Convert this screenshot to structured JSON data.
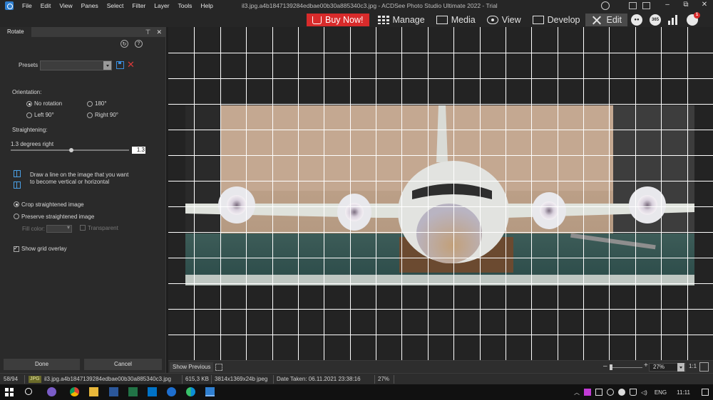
{
  "menu": [
    "File",
    "Edit",
    "View",
    "Panes",
    "Select",
    "Filter",
    "Layer",
    "Tools",
    "Help"
  ],
  "window_title": "il3.jpg.a4b1847139284edbae00b30a885340c3.jpg - ACDSee Photo Studio Ultimate 2022 - Trial",
  "window_controls": {
    "minimize": "–",
    "restore": "⧉",
    "close": "✕"
  },
  "modes": {
    "buy_now": "Buy Now!",
    "manage": "Manage",
    "media": "Media",
    "view": "View",
    "develop": "Develop",
    "edit": "Edit"
  },
  "toolbar_icons": {
    "services_badge": "365",
    "notification_count": "1"
  },
  "panel": {
    "tab": "Rotate",
    "presets_label": "Presets",
    "orientation_label": "Orientation:",
    "orientation_options": [
      "No rotation",
      "180°",
      "Left 90°",
      "Right 90°"
    ],
    "orientation_selected": "No rotation",
    "straightening_label": "Straightening:",
    "straighten_caption": "1.3 degrees right",
    "straighten_value": "1.3",
    "straighten_fraction": 0.5,
    "draw_line_text_1": "Draw a line on the image that you want",
    "draw_line_text_2": "to become vertical or horizontal",
    "crop_option": "Crop straightened image",
    "preserve_option": "Preserve straightened image",
    "fill_color_label": "Fill color:",
    "transparent_label": "Transparent",
    "show_grid_label": "Show grid overlay",
    "show_grid_checked": true,
    "done_label": "Done",
    "cancel_label": "Cancel"
  },
  "canvas_toolbar": {
    "show_previous": "Show Previous",
    "zoom_value": "27%",
    "zoom_1to1": "1:1"
  },
  "status": {
    "counter": "58/94",
    "format_badge": "JPG",
    "filename": "il3.jpg.a4b1847139284edbae00b30a885340c3.jpg",
    "filesize": "615,3 KB",
    "dimensions": "3814x1369x24b jpeg",
    "date_taken": "Date Taken: 06.11.2021 23:38:16",
    "zoom": "27%"
  },
  "taskbar": {
    "language": "ENG",
    "time": "11:11"
  },
  "colors": {
    "buy_now_bg": "#d82b2b",
    "accent_blue": "#3b8fe0",
    "grid_line": "#ffffff"
  }
}
